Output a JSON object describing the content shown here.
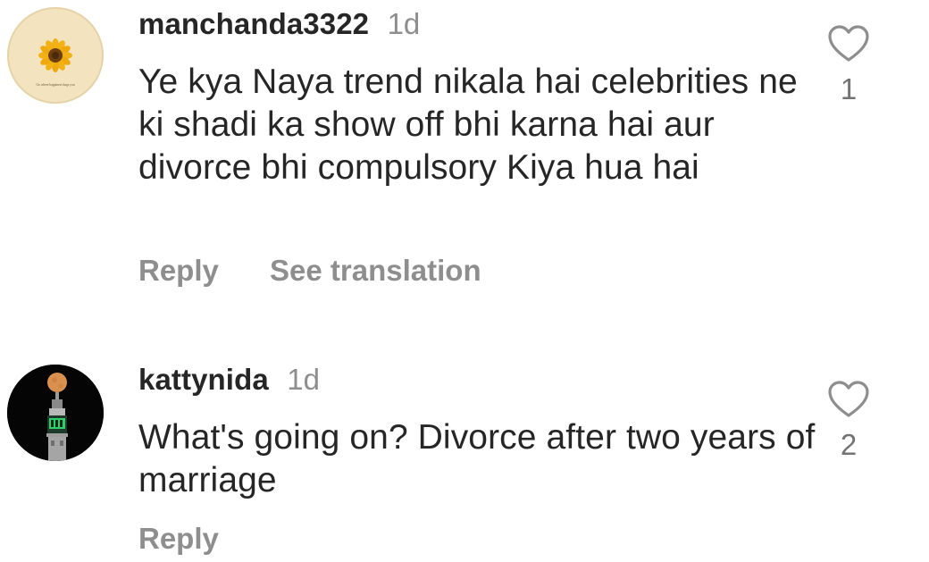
{
  "comments": [
    {
      "username": "manchanda3322",
      "time": "1d",
      "text": "Ye kya Naya trend nikala hai celebrities ne ki shadi ka show off bhi karna hai aur divorce bhi compulsory Kiya hua hai",
      "reply_label": "Reply",
      "translate_label": "See translation",
      "like_count": "1",
      "avatar_caption": "Go where happiness hugs you",
      "avatar_icon": "sunflower-icon"
    },
    {
      "username": "kattynida",
      "time": "1d",
      "text": "What's going on? Divorce after two years of marriage",
      "reply_label": "Reply",
      "like_count": "2",
      "avatar_icon": "night-tower-moon-icon"
    }
  ],
  "icons": {
    "like": "heart-outline-icon"
  },
  "colors": {
    "text": "#262626",
    "muted": "#8e8e8e",
    "background": "#ffffff"
  }
}
